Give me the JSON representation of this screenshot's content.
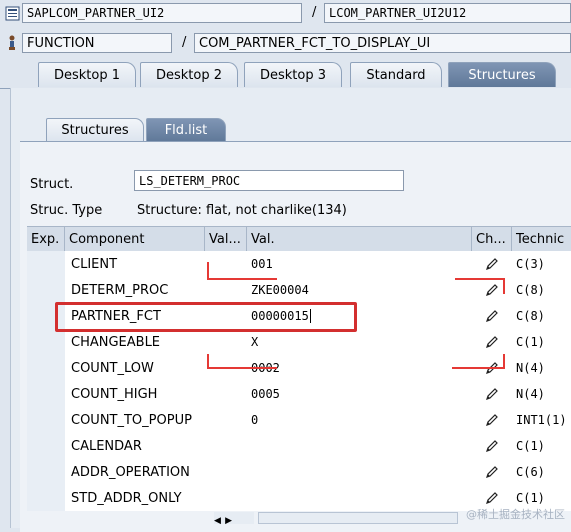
{
  "header": {
    "program": "SAPLCOM_PARTNER_UI2",
    "separator1": "/",
    "include": "LCOM_PARTNER_UI2U12",
    "type": "FUNCTION",
    "separator2": "/",
    "function_name": "COM_PARTNER_FCT_TO_DISPLAY_UI"
  },
  "tabs": [
    "Desktop 1",
    "Desktop 2",
    "Desktop 3",
    "Standard",
    "Structures"
  ],
  "active_tab": "Structures",
  "subtabs": [
    "Structures",
    "Fld.list"
  ],
  "active_subtab": "Fld.list",
  "struct": {
    "label": "Struct.",
    "value": "LS_DETERM_PROC",
    "type_label": "Struc. Type",
    "type_value": "Structure: flat, not charlike(134)"
  },
  "table": {
    "columns": [
      "Exp.",
      "Component",
      "Val...",
      "Val.",
      "Ch...",
      "Technic"
    ],
    "rows": [
      {
        "component": "CLIENT",
        "val": "001",
        "tech": "C(3)"
      },
      {
        "component": "DETERM_PROC",
        "val": "ZKE00004",
        "tech": "C(8)"
      },
      {
        "component": "PARTNER_FCT",
        "val": "00000015",
        "tech": "C(8)"
      },
      {
        "component": "CHANGEABLE",
        "val": "X",
        "tech": "C(1)"
      },
      {
        "component": "COUNT_LOW",
        "val": "0002",
        "tech": "N(4)"
      },
      {
        "component": "COUNT_HIGH",
        "val": "0005",
        "tech": "N(4)"
      },
      {
        "component": "COUNT_TO_POPUP",
        "val": "0",
        "tech": "INT1(1)"
      },
      {
        "component": "CALENDAR",
        "val": "",
        "tech": "C(1)"
      },
      {
        "component": "ADDR_OPERATION",
        "val": "",
        "tech": "C(6)"
      },
      {
        "component": "STD_ADDR_ONLY",
        "val": "",
        "tech": "C(1)"
      }
    ]
  },
  "watermark": "@稀土掘金技术社区",
  "colors": {
    "highlight": "#d32f2f",
    "active_tab": "#6b83a3"
  }
}
